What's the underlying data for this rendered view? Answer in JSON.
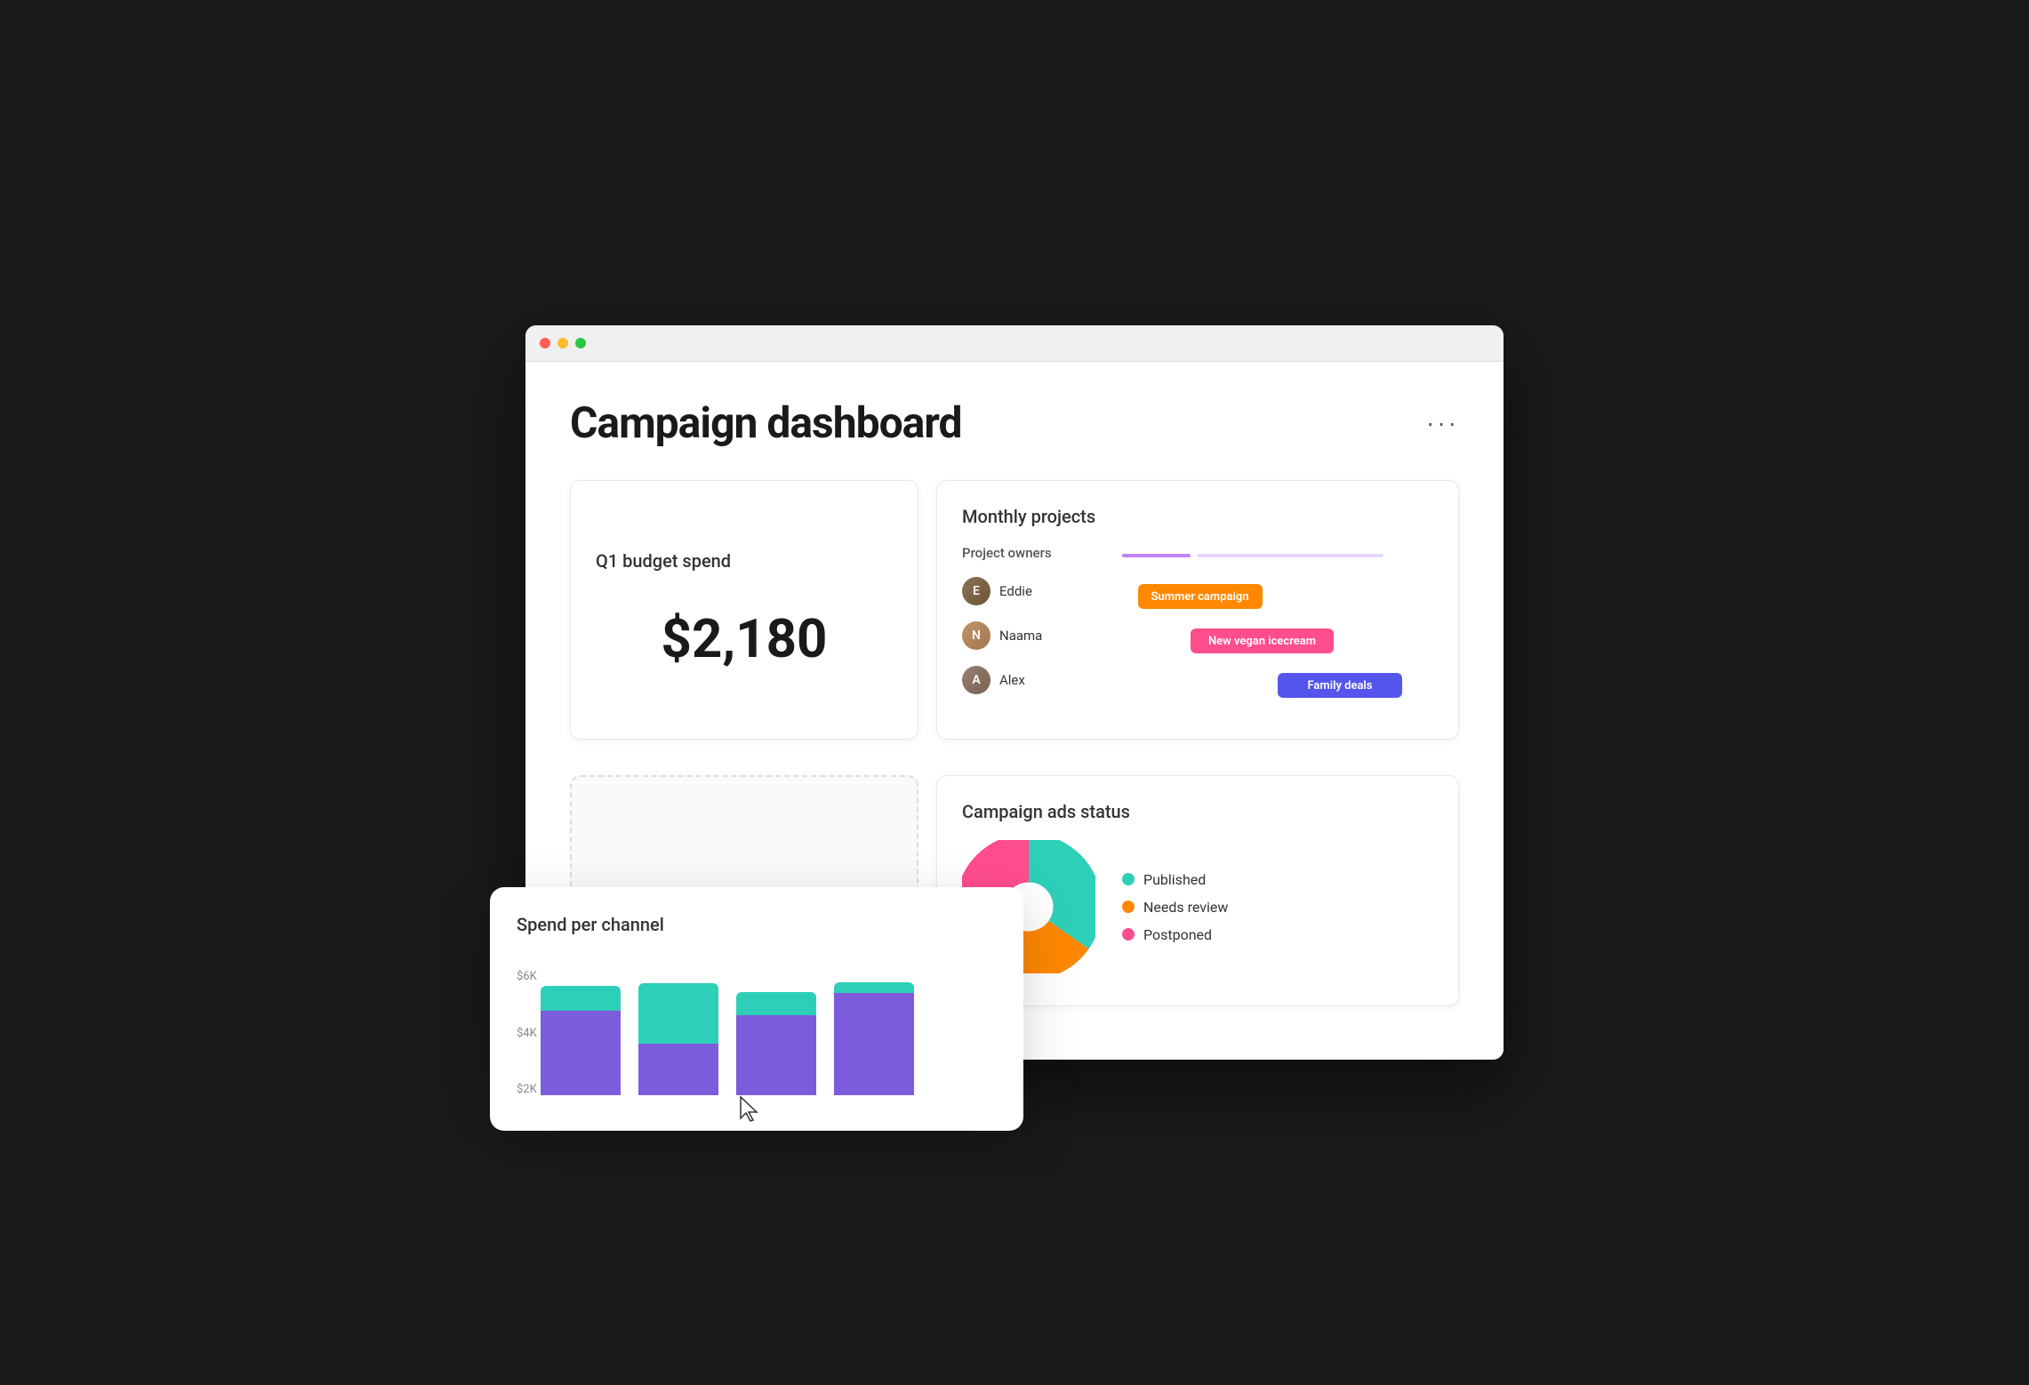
{
  "browser": {
    "dots": [
      "red",
      "yellow",
      "green"
    ]
  },
  "dashboard": {
    "title": "Campaign dashboard",
    "more_menu": "···"
  },
  "budget_card": {
    "title": "Q1 budget spend",
    "amount": "$2,180"
  },
  "monthly_card": {
    "title": "Monthly projects",
    "owners_label": "Project owners",
    "owners": [
      {
        "name": "Eddie",
        "initials": "E"
      },
      {
        "name": "Naama",
        "initials": "N"
      },
      {
        "name": "Alex",
        "initials": "A"
      }
    ],
    "gantt_bars": [
      {
        "label": "Summer campaign",
        "color": "bar-summer",
        "left": "5%",
        "width": "38%"
      },
      {
        "label": "New vegan icecream",
        "color": "bar-vegan",
        "left": "22%",
        "width": "44%"
      },
      {
        "label": "Family deals",
        "color": "bar-family",
        "left": "50%",
        "width": "38%"
      }
    ]
  },
  "spend_card": {
    "title": "Spend per channel",
    "y_labels": [
      "$6K",
      "$4K",
      "$2K"
    ],
    "bars": [
      {
        "top_h": 28,
        "bottom_h": 95
      },
      {
        "top_h": 70,
        "bottom_h": 60
      },
      {
        "top_h": 28,
        "bottom_h": 88
      },
      {
        "top_h": 12,
        "bottom_h": 112
      }
    ],
    "colors": {
      "top": "#2ecfb8",
      "bottom": "#7c5cdb"
    }
  },
  "ads_card": {
    "title": "Campaign ads status",
    "legend": [
      {
        "label": "Published",
        "color_class": "dot-published"
      },
      {
        "label": "Needs review",
        "color_class": "dot-review"
      },
      {
        "label": "Postponed",
        "color_class": "dot-postponed"
      }
    ],
    "pie": {
      "published_pct": 35,
      "review_pct": 40,
      "postponed_pct": 25
    }
  }
}
